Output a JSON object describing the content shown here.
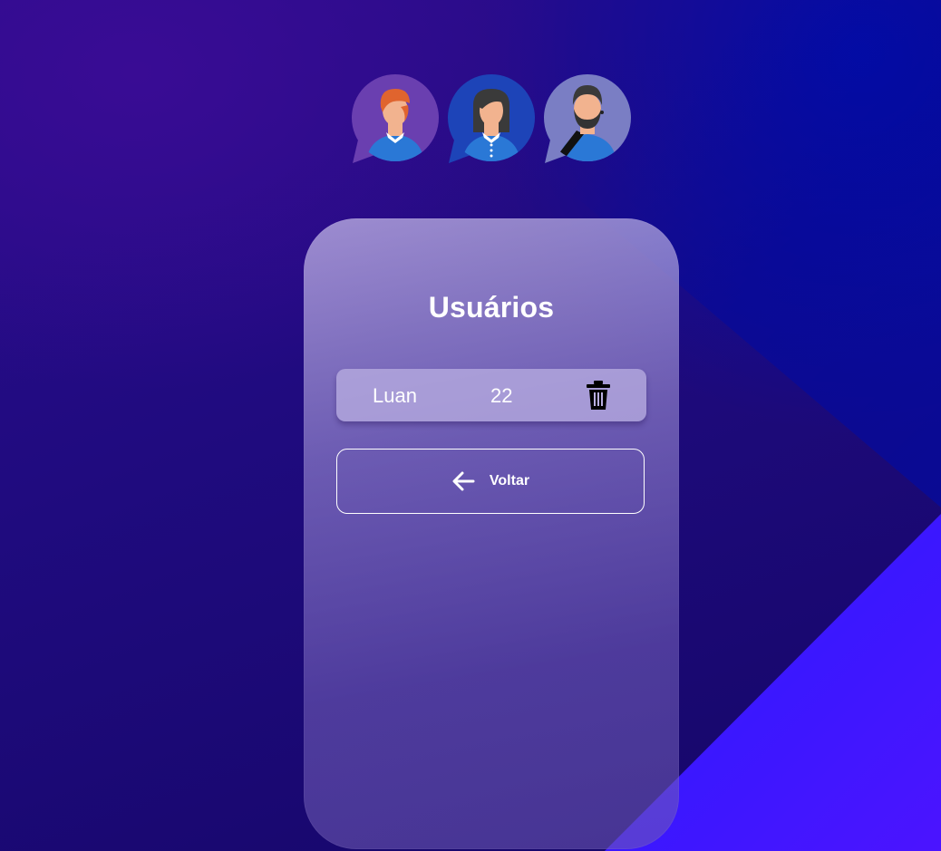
{
  "page": {
    "title": "Usuários"
  },
  "avatars": [
    {
      "icon": "male-orange-hair-avatar-icon"
    },
    {
      "icon": "female-avatar-icon"
    },
    {
      "icon": "bearded-male-avatar-icon"
    }
  ],
  "users": [
    {
      "name": "Luan",
      "age": "22",
      "delete_icon": "trash-icon"
    }
  ],
  "actions": {
    "back_label": "Voltar",
    "back_icon": "arrow-left-icon"
  },
  "colors": {
    "background_primary": "#1f0b7e",
    "background_corner": "#4b14ff",
    "card": "#a79bd6",
    "text": "#ffffff"
  }
}
